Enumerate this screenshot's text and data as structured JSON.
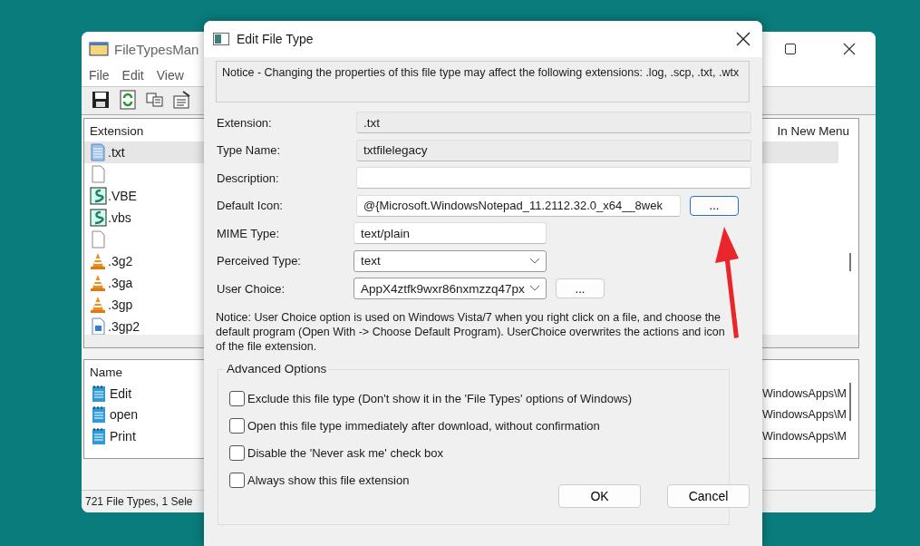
{
  "background_window": {
    "title": "FileTypesMan",
    "menu": [
      "File",
      "Edit",
      "View"
    ],
    "toolbar": [
      {
        "kind": "save"
      },
      {
        "kind": "refresh"
      },
      {
        "kind": "copy"
      },
      {
        "kind": "properties"
      }
    ],
    "file_types_list": {
      "columns": [
        "Extension",
        "In New Menu"
      ],
      "rows": [
        {
          "extension": ".txt",
          "kind": "text-file",
          "selected": true
        },
        {
          "kind": "blank",
          "selected": false
        },
        {
          "extension": ".VBE",
          "kind": "script",
          "selected": false
        },
        {
          "extension": ".vbs",
          "kind": "script",
          "selected": false
        },
        {
          "kind": "blank",
          "selected": false
        },
        {
          "extension": ".3g2",
          "kind": "cone",
          "selected": false
        },
        {
          "extension": ".3ga",
          "kind": "cone",
          "selected": false
        },
        {
          "extension": ".3gp",
          "kind": "cone",
          "selected": false
        },
        {
          "extension": ".3gp2",
          "kind": "video",
          "selected": false
        }
      ]
    },
    "actions_list": {
      "columns": [
        "Name"
      ],
      "rows": [
        {
          "name": "Edit",
          "column_2": "WindowsApps\\M"
        },
        {
          "name": "open",
          "column_2": "WindowsApps\\M"
        },
        {
          "name": "Print",
          "column_2": "WindowsApps\\M"
        }
      ]
    },
    "status_bar": "721 File Types, 1 Sele"
  },
  "dialog": {
    "title": "Edit File Type",
    "notice": "Notice - Changing the properties of this file type may affect the following extensions: .log, .scp, .txt, .wtx",
    "fields": [
      {
        "label": "Extension:",
        "value": ".txt",
        "kind": "readonly"
      },
      {
        "label": "Type Name:",
        "value": "txtfilelegacy",
        "kind": "readonly"
      },
      {
        "label": "Description:",
        "kind": "wide"
      },
      {
        "label": "Default Icon:",
        "value": "@{Microsoft.WindowsNotepad_11.2112.32.0_x64__8wek",
        "kind": "browse",
        "button": "...",
        "focused": true
      },
      {
        "label": "MIME Type:",
        "value": "text/plain",
        "kind": "short"
      },
      {
        "label": "Perceived Type:",
        "value": "text",
        "kind": "select"
      },
      {
        "label": "User Choice:",
        "value": "AppX4ztfk9wxr86nxmzzq47px",
        "kind": "select",
        "button": "...",
        "focused": false
      }
    ],
    "user_choice_notice": "Notice: User Choice option is used on Windows Vista/7 when you right click on a file, and choose the default program (Open With -> Choose Default Program). UserChoice overwrites the actions and icon of the file extension.",
    "advanced_options": {
      "title": "Advanced Options",
      "options": [
        {
          "label": "Exclude  this file type (Don't show it in the 'File Types' options of Windows)",
          "checked": false
        },
        {
          "label": "Open this file type immediately after download, without confirmation",
          "checked": false
        },
        {
          "label": "Disable the 'Never ask me' check box",
          "checked": false
        },
        {
          "label": "Always show this file extension",
          "checked": false
        }
      ]
    },
    "buttons": [
      "OK",
      "Cancel"
    ]
  }
}
